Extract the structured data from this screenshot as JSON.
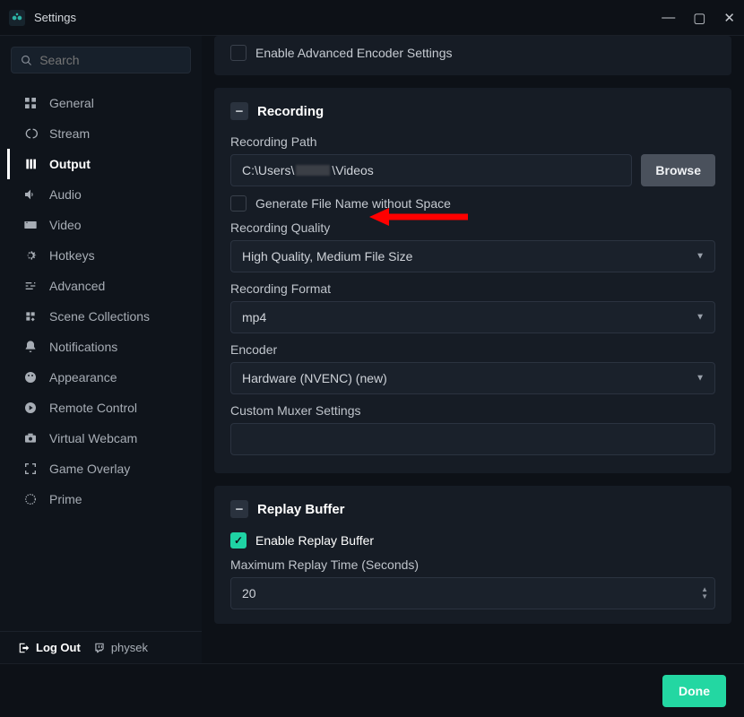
{
  "window": {
    "title": "Settings"
  },
  "search": {
    "placeholder": "Search"
  },
  "sidebar": {
    "items": [
      {
        "label": "General",
        "icon": "grid-icon"
      },
      {
        "label": "Stream",
        "icon": "signal-icon"
      },
      {
        "label": "Output",
        "icon": "output-icon",
        "selected": true
      },
      {
        "label": "Audio",
        "icon": "speaker-icon"
      },
      {
        "label": "Video",
        "icon": "video-icon"
      },
      {
        "label": "Hotkeys",
        "icon": "gear-icon"
      },
      {
        "label": "Advanced",
        "icon": "sliders-icon"
      },
      {
        "label": "Scene Collections",
        "icon": "collection-icon"
      },
      {
        "label": "Notifications",
        "icon": "bell-icon"
      },
      {
        "label": "Appearance",
        "icon": "theme-icon"
      },
      {
        "label": "Remote Control",
        "icon": "remote-icon"
      },
      {
        "label": "Virtual Webcam",
        "icon": "camera-icon"
      },
      {
        "label": "Game Overlay",
        "icon": "overlay-icon"
      },
      {
        "label": "Prime",
        "icon": "prime-icon"
      }
    ]
  },
  "encoder_panel": {
    "advanced_checkbox_label": "Enable Advanced Encoder Settings"
  },
  "recording": {
    "title": "Recording",
    "path_label": "Recording Path",
    "path_value_prefix": "C:\\Users\\",
    "path_value_suffix": "\\Videos",
    "browse_label": "Browse",
    "gen_filename_label": "Generate File Name without Space",
    "quality_label": "Recording Quality",
    "quality_value": "High Quality, Medium File Size",
    "format_label": "Recording Format",
    "format_value": "mp4",
    "encoder_label": "Encoder",
    "encoder_value": "Hardware (NVENC) (new)",
    "muxer_label": "Custom Muxer Settings",
    "muxer_value": ""
  },
  "replay": {
    "title": "Replay Buffer",
    "enable_label": "Enable Replay Buffer",
    "enable_checked": true,
    "max_time_label": "Maximum Replay Time (Seconds)",
    "max_time_value": "20"
  },
  "footer": {
    "logout_label": "Log Out",
    "username": "physek"
  },
  "buttons": {
    "done": "Done"
  },
  "colors": {
    "accent": "#23d7a2",
    "arrow": "#ff0000"
  }
}
